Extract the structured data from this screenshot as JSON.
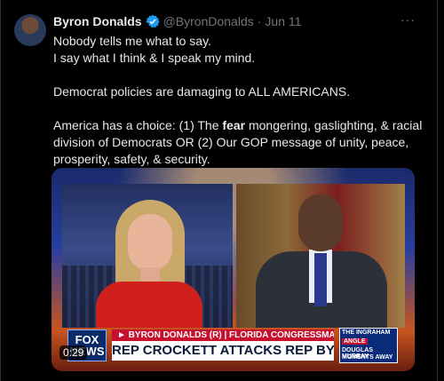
{
  "tweet": {
    "author_name": "Byron Donalds",
    "handle": "@ByronDonalds",
    "separator": "·",
    "date": "Jun 11",
    "more_icon": "more-icon",
    "verified_color": "#1d9bf0",
    "lines": [
      "Nobody tells me what to say.",
      "I say what I think & I speak my mind.",
      "Democrat policies are damaging to ALL AMERICANS."
    ],
    "para3_before": "America has a choice: (1) The ",
    "para3_bold": "fear",
    "para3_after": " mongering, gaslighting, & racial division of Democrats OR (2) Our GOP message of unity, peace, prosperity, safety, & security."
  },
  "video": {
    "timestamp": "0:29",
    "network_logo": "FOX NEWS",
    "lower_third_top": "► BYRON DONALDS (R) | FLORIDA CONGRESSMAN",
    "headline": "REP CROCKETT ATTACKS REP BYRON DONALDS",
    "promo": {
      "line1": "THE INGRAHAM",
      "line2": "ANGLE",
      "line3": "DOUGLAS MURRAY",
      "line4": "MOMENTS AWAY"
    }
  }
}
